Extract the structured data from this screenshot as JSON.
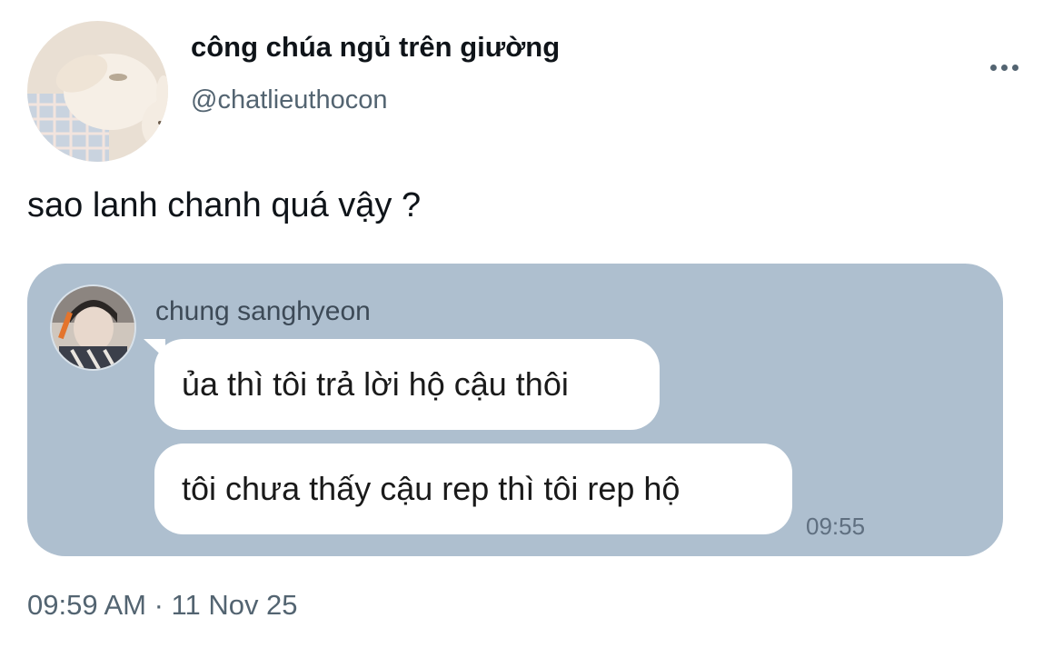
{
  "author": {
    "display_name": "công chúa ngủ trên giường",
    "handle": "@chatlieuthocon",
    "avatar_icon": "sleeping-bunny-avatar"
  },
  "more_icon": "more-horizontal-icon",
  "tweet": {
    "text": "sao lanh chanh quá vậy ?",
    "timestamp": "09:59 AM · 11 Nov 25"
  },
  "chat": {
    "background_color": "#aebfcf",
    "sender_name": "chung sanghyeon",
    "sender_avatar_icon": "person-avatar",
    "messages": [
      {
        "text": "ủa thì tôi trả lời hộ cậu thôi"
      },
      {
        "text": "tôi chưa thấy cậu rep thì tôi rep hộ"
      }
    ],
    "time": "09:55"
  },
  "colors": {
    "text_primary": "#0f1419",
    "text_secondary": "#536471",
    "bubble": "#ffffff"
  }
}
